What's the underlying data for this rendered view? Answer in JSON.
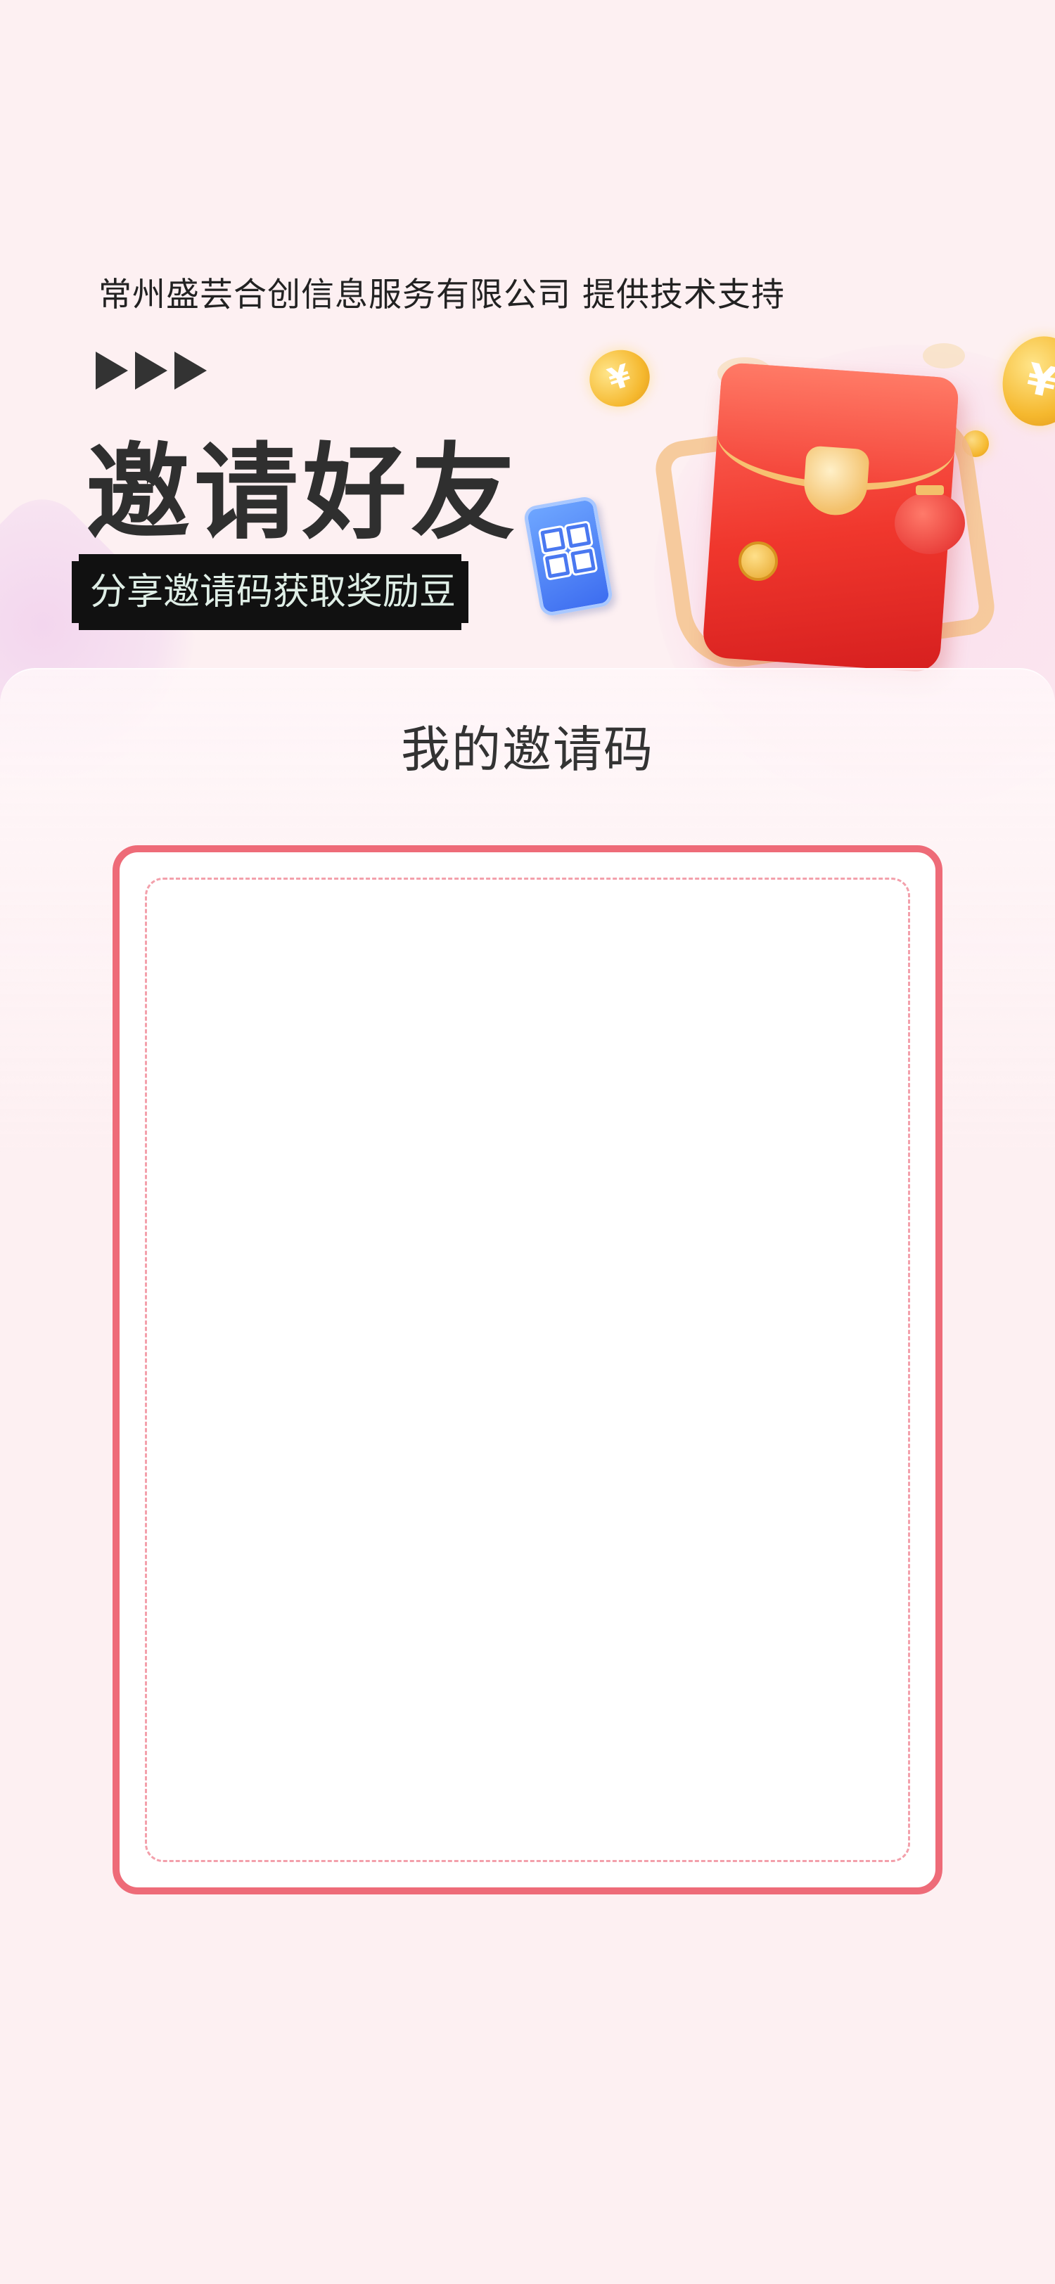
{
  "header": {
    "support_text": "常州盛芸合创信息服务有限公司 提供技术支持",
    "title": "邀请好友",
    "subtitle": "分享邀请码获取奖励豆"
  },
  "illustration": {
    "coin_symbol": "¥",
    "icons": [
      "qr-phone-icon",
      "red-envelope-icon",
      "coin-icon",
      "lantern-icon"
    ]
  },
  "card": {
    "title": "我的邀请码"
  },
  "colors": {
    "background": "#fdf0f2",
    "frame_border": "#ee6b78",
    "frame_dash": "#f3a0ab",
    "title_text": "#2f2f2f"
  }
}
